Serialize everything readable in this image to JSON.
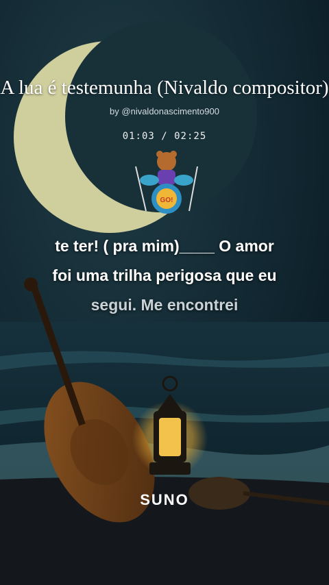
{
  "title": "A lua é testemunha (Nivaldo compositor)",
  "byline": "by @nivaldonascimento900",
  "time": "01:03 / 02:25",
  "lyrics": {
    "line1": "te ter! ( pra mim)____ O amor",
    "line2": "foi uma trilha perigosa que eu",
    "line3": "segui. Me encontrei"
  },
  "logo": "SUNO",
  "colors": {
    "background": "#0d2230",
    "moon": "#d9d7a2",
    "lyric_active": "#ffffff",
    "lyric_dim": "#c9d2d6"
  }
}
